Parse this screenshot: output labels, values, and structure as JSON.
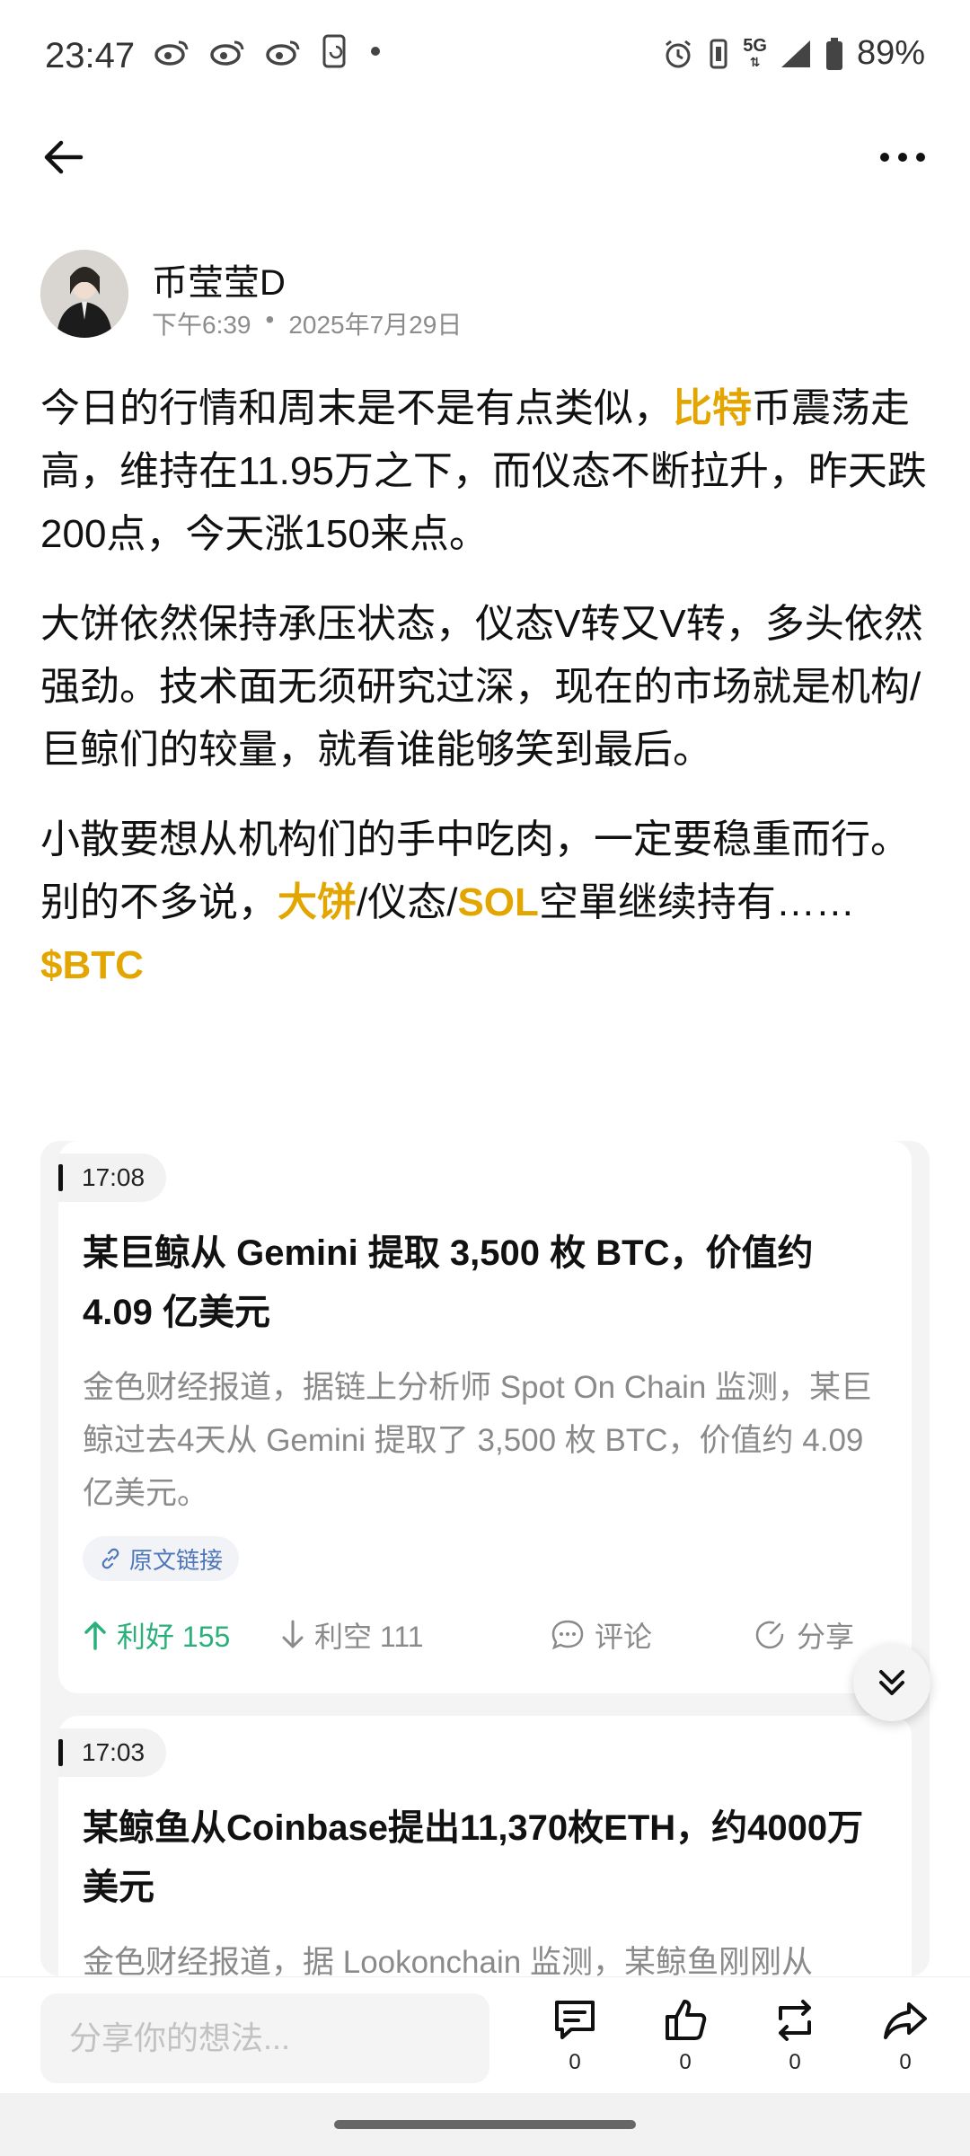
{
  "status_bar": {
    "time": "23:47",
    "left_icons": [
      "weibo-icon",
      "weibo-icon",
      "weibo-icon",
      "phone-sync-icon",
      "dot-icon"
    ],
    "right_icons": [
      "alarm-icon",
      "vibrate-icon",
      "5g-icon",
      "signal-icon",
      "battery-icon"
    ],
    "network": "5G",
    "battery": "89%"
  },
  "topnav": {
    "back_icon": "back-arrow-icon",
    "more_icon": "more-dots-icon"
  },
  "author": {
    "name": "币莹莹D",
    "time": "下午6:39",
    "separator": "•",
    "date": "2025年7月29日"
  },
  "post": {
    "p1": {
      "a": "今日的行情和周末是不是有点类似，",
      "hl": "比特",
      "b": "币震荡走高，维持在11.95万之下，而仪态不断拉升，昨天跌200点，今天涨150来点。"
    },
    "p2": {
      "text": "大饼依然保持承压状态，仪态V转又V转，多头依然强劲。技术面无须研究过深，现在的市场就是机构/巨鲸们的较量，就看谁能够笑到最后。"
    },
    "p3": {
      "a": "小散要想从机构们的手中吃肉，一定要稳重而行。别的不多说，",
      "hl1": "大饼",
      "b": "/仪态/",
      "hl2": "SOL",
      "c": "空單继续持有……",
      "hl3": "$BTC"
    },
    "highlight_color": "#e3a500"
  },
  "news": [
    {
      "time": "17:08",
      "title": "某巨鲸从 Gemini 提取 3,500 枚 BTC，价值约 4.09 亿美元",
      "summary": "金色财经报道，据链上分析师 Spot On Chain 监测，某巨鲸过去4天从 Gemini 提取了 3,500 枚 BTC，价值约 4.09 亿美元。",
      "source_link": "原文链接",
      "bullish": "利好 155",
      "bearish": "利空 111",
      "comment": "评论",
      "share": "分享"
    },
    {
      "time": "17:03",
      "title": "某鲸鱼从Coinbase提出11,370枚ETH，约4000万美元",
      "summary": "金色财经报道，据 Lookonchain 监测，某鲸鱼刚刚从"
    }
  ],
  "colors": {
    "bullish": "#2ab07a",
    "link": "#4f76b8"
  },
  "bottom_bar": {
    "placeholder": "分享你的想法...",
    "comment_count": "0",
    "like_count": "0",
    "repost_count": "0",
    "share_count": "0"
  }
}
